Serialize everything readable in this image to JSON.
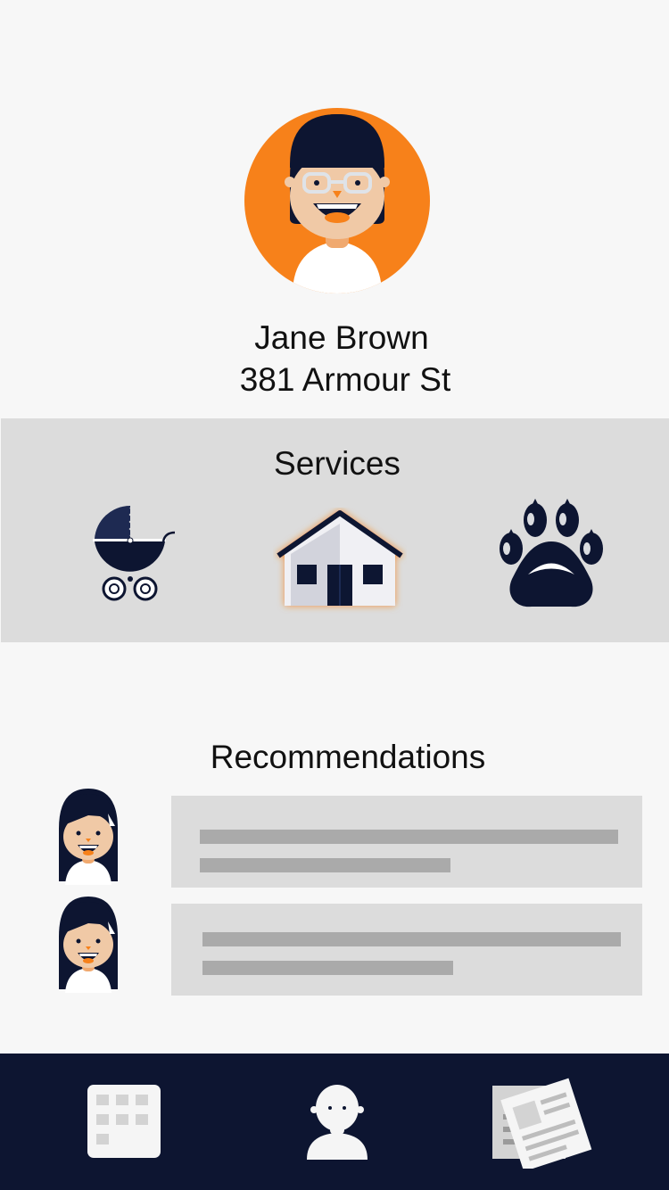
{
  "profile": {
    "name": "Jane Brown",
    "address": "381 Armour St",
    "avatar_icon": "user-avatar-icon"
  },
  "services": {
    "title": "Services",
    "items": [
      {
        "label": "Childcare",
        "icon": "stroller-icon"
      },
      {
        "label": "House sitting",
        "icon": "house-icon",
        "selected": true
      },
      {
        "label": "Pet care",
        "icon": "paw-icon"
      }
    ]
  },
  "recommendations": {
    "title": "Recommendations",
    "items": [
      {
        "avatar_icon": "recommender-avatar-icon",
        "placeholder": true
      },
      {
        "avatar_icon": "recommender-avatar-icon",
        "placeholder": true
      }
    ]
  },
  "bottom_nav": {
    "items": [
      {
        "label": "Calendar",
        "icon": "calendar-icon"
      },
      {
        "label": "Profile",
        "icon": "profile-icon"
      },
      {
        "label": "News",
        "icon": "news-icon"
      }
    ]
  },
  "colors": {
    "accent": "#f7811a",
    "navy": "#0d1531",
    "panel": "#dcdcdc",
    "background": "#f7f7f7"
  }
}
